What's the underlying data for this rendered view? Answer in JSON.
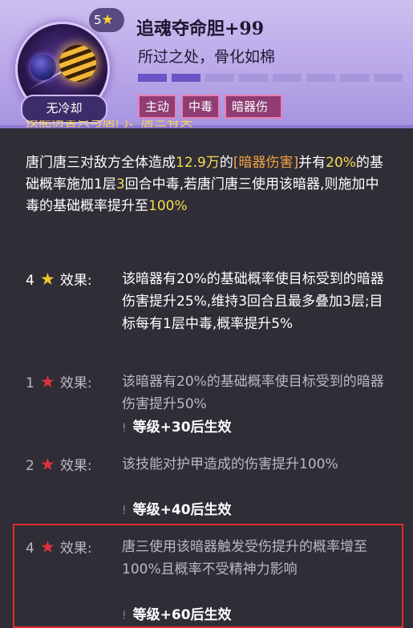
{
  "skill": {
    "level": "5",
    "name": "追魂夺命胆+99",
    "subtitle": "所过之处，骨化如棉",
    "cooldown": "无冷却",
    "progress_filled": 2,
    "progress_total": 8,
    "tags": [
      "主动",
      "中毒",
      "暗器伤"
    ]
  },
  "peek_text": "技能伤害只与唐门、唐三有关",
  "description": {
    "p1": "唐门唐三对敌方全体造成",
    "dmg": "12.9万",
    "p2": "的",
    "kw": "[暗器伤害]",
    "p3": "并有",
    "rate": "20%",
    "p4": "的基础概率施加1层",
    "turns": "3",
    "p5": "回合中毒,若唐门唐三使用该暗器,则施加中毒的基础概率提升至",
    "rate2": "100%"
  },
  "effects": [
    {
      "stars": "4",
      "star_color": "gold",
      "label": "效果:",
      "text": "该暗器有20%的基础概率使目标受到的暗器伤害提升25%,维持3回合且最多叠加3层;目标每有1层中毒,概率提升5%",
      "requirement": ""
    },
    {
      "stars": "1",
      "star_color": "red",
      "label": "效果:",
      "text": "该暗器有20%的基础概率使目标受到的暗器伤害提升50%",
      "requirement": "等级+30后生效"
    },
    {
      "stars": "2",
      "star_color": "red",
      "label": "效果:",
      "text": "该技能对护甲造成的伤害提升100%",
      "requirement": "等级+40后生效"
    },
    {
      "stars": "4",
      "star_color": "red",
      "label": "效果:",
      "text": "唐三使用该暗器触发受伤提升的概率增至100%且概率不受精神力影响",
      "requirement": "等级+60后生效"
    }
  ],
  "colors": {
    "accent_gold": "#f6dd52",
    "accent_orange": "#f1a241",
    "highlight_box": "#e22a2a"
  }
}
